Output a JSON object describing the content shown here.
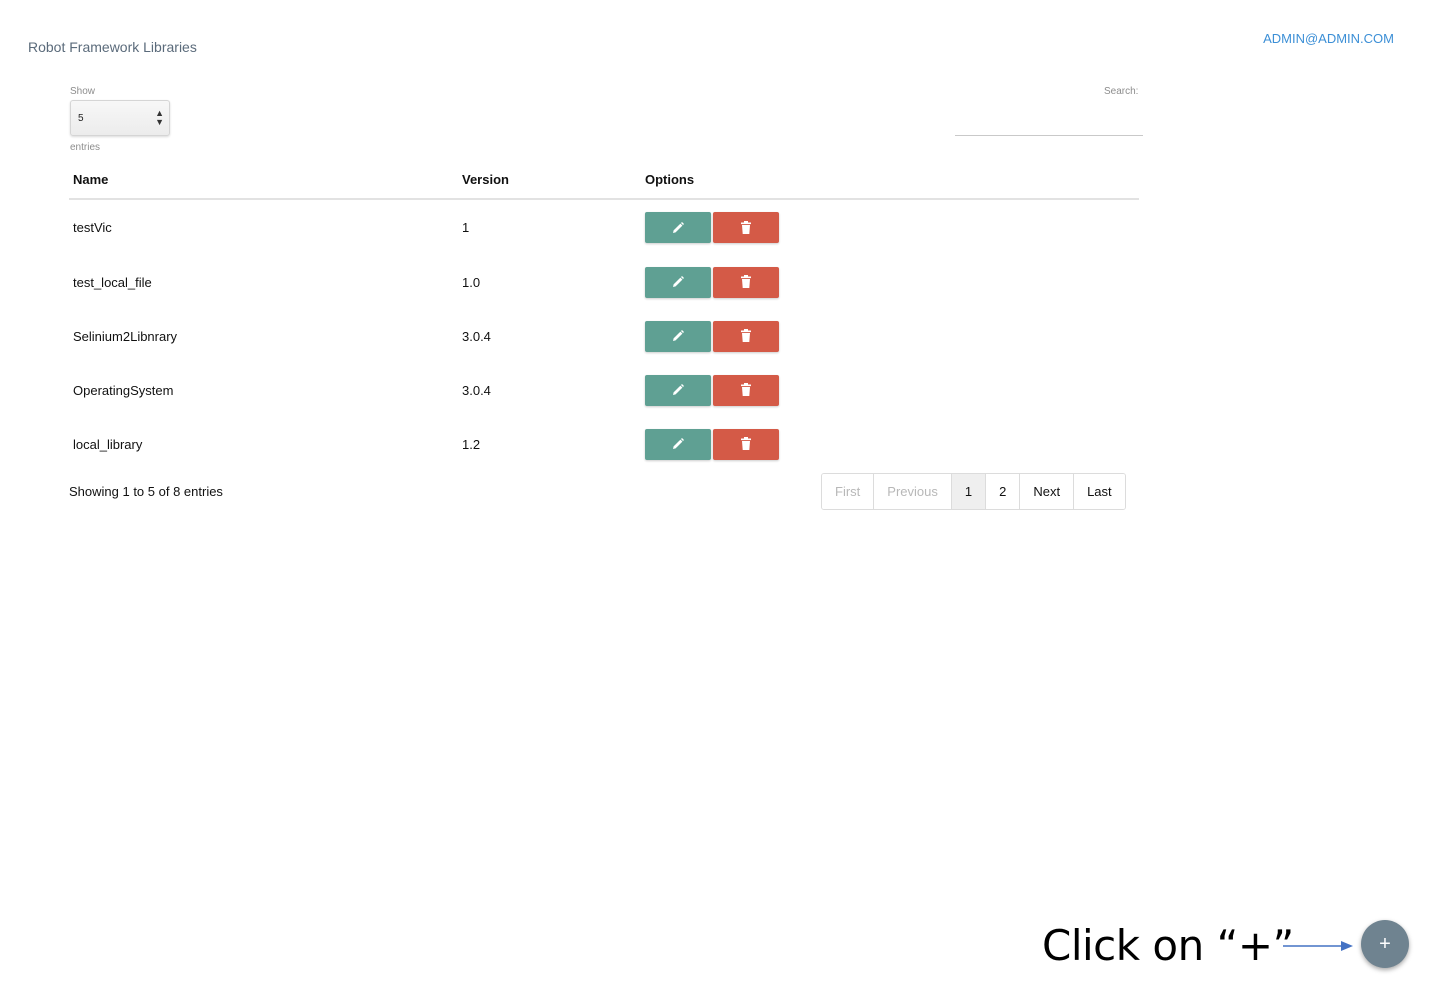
{
  "header": {
    "brand": "Robot Framework Libraries",
    "user": "ADMIN@ADMIN.COM"
  },
  "controls": {
    "show_label": "Show",
    "length_value": "5",
    "entries_label": "entries",
    "search_label": "Search:",
    "search_value": ""
  },
  "table": {
    "columns": [
      "Name",
      "Version",
      "Options"
    ],
    "rows": [
      {
        "name": "testVic",
        "version": "1"
      },
      {
        "name": "test_local_file",
        "version": "1.0"
      },
      {
        "name": "Selinium2Libnrary",
        "version": "3.0.4"
      },
      {
        "name": "OperatingSystem",
        "version": "3.0.4"
      },
      {
        "name": "local_library",
        "version": "1.2"
      }
    ]
  },
  "footer": {
    "info": "Showing 1 to 5 of 8 entries",
    "pagination": {
      "first": "First",
      "previous": "Previous",
      "pages": [
        "1",
        "2"
      ],
      "next": "Next",
      "last": "Last"
    }
  },
  "annotation": {
    "hint": "Click on “+”"
  },
  "fab": {
    "label": "+"
  },
  "icons": {
    "edit": "pencil-icon",
    "delete": "trash-icon"
  },
  "colors": {
    "edit_button": "#5fa093",
    "delete_button": "#d45a47",
    "fab": "#6f8390",
    "link": "#3c8fd6"
  }
}
